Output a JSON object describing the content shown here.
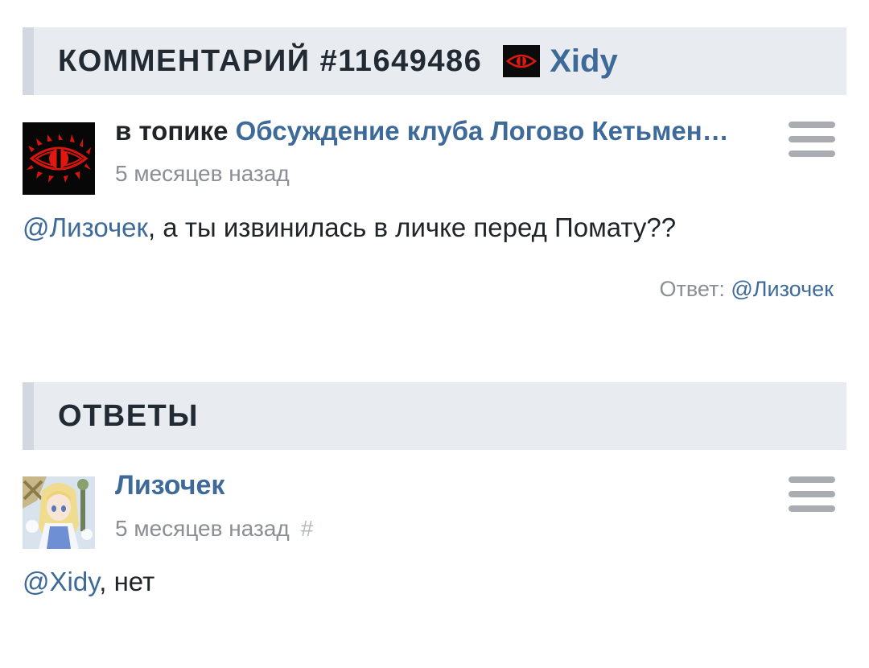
{
  "comment_header": {
    "title": "КОММЕНТАРИЙ #11649486",
    "author": "Xidy",
    "author_icon": "red-eye-icon"
  },
  "comment": {
    "topic_prefix": "в топике",
    "topic_title": "Обсуждение клуба Логово Кетьмен…",
    "time": "5 месяцев назад",
    "mention": "@Лизочек",
    "text": ", а ты извинилась в личке перед Помату??",
    "reply_label": "Ответ:",
    "reply_mention": "@Лизочек"
  },
  "answers_header": {
    "title": "ОТВЕТЫ"
  },
  "answers": [
    {
      "username": "Лизочек",
      "time": "5 месяцев назад",
      "hash": "#",
      "mention": "@Xidy",
      "text": ", нет"
    }
  ],
  "colors": {
    "link": "#3d6a98",
    "header_bg": "#e8ebf0",
    "header_accent": "#d3d8e0",
    "eye_red": "#e0180f"
  }
}
